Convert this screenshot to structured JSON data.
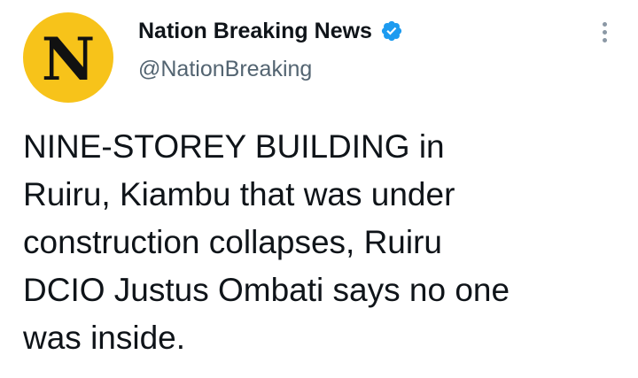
{
  "account": {
    "avatar_letter": "N",
    "avatar_color": "#f7c31a",
    "display_name": "Nation Breaking News",
    "verified": true,
    "verified_icon": "verified-badge-icon",
    "verified_color": "#1d9bf0",
    "handle": "@NationBreaking"
  },
  "more_menu_icon": "more-vertical-icon",
  "tweet": {
    "lines": [
      "NINE-STOREY BUILDING in",
      "Ruiru, Kiambu that was under",
      "construction collapses, Ruiru",
      "DCIO Justus Ombati says no one",
      "was inside."
    ]
  }
}
